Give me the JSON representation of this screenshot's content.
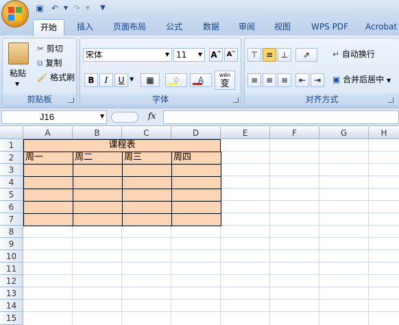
{
  "colors": {
    "table_fill": "#fcd5b4",
    "accent": "#15428b",
    "font_color_bar": "#ff0000",
    "highlight_bar": "#ffff00"
  },
  "quick_access": {
    "icons": [
      "save-icon",
      "undo-icon",
      "redo-icon",
      "customize-icon"
    ]
  },
  "tabs": [
    {
      "label": "开始",
      "active": true
    },
    {
      "label": "插入"
    },
    {
      "label": "页面布局"
    },
    {
      "label": "公式"
    },
    {
      "label": "数据"
    },
    {
      "label": "审阅"
    },
    {
      "label": "视图"
    },
    {
      "label": "WPS PDF"
    },
    {
      "label": "Acrobat"
    }
  ],
  "clipboard": {
    "paste": "粘贴",
    "cut": "剪切",
    "copy": "复制",
    "format_painter": "格式刷",
    "group": "剪贴板"
  },
  "font": {
    "name": "宋体",
    "size": "11",
    "bold": "B",
    "italic": "I",
    "underline": "U",
    "phonetic": "wén",
    "phonetic_char": "变",
    "group": "字体"
  },
  "alignment": {
    "wrap": "自动换行",
    "merge": "合并后居中",
    "group": "对齐方式"
  },
  "formula_bar": {
    "name_box": "J16",
    "fx": "fx"
  },
  "sheet": {
    "columns": [
      "A",
      "B",
      "C",
      "D",
      "E",
      "F",
      "G",
      "H"
    ],
    "rows": [
      "1",
      "2",
      "3",
      "4",
      "5",
      "6",
      "7",
      "8",
      "9",
      "10",
      "11",
      "12",
      "13",
      "14",
      "15"
    ],
    "title": "课程表",
    "headers": [
      "周一",
      "周二",
      "周三",
      "周四"
    ]
  }
}
